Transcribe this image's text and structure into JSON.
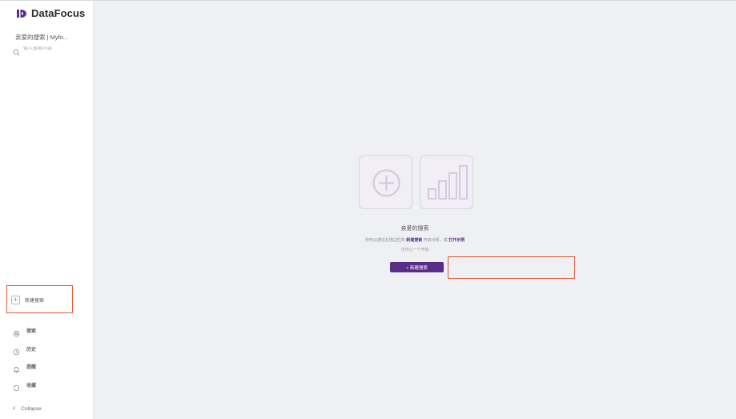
{
  "app": {
    "name": "DataFocus",
    "brand_color": "#5a2d88",
    "highlight_color": "#e05a3a"
  },
  "sidebar": {
    "workspace_label": "亲爱的搜索 | Myfo...",
    "search_placeholder": "输入搜索内容",
    "new_search_label": "新建搜索",
    "nav_items": [
      {
        "icon": "search-icon",
        "label": "搜索"
      },
      {
        "icon": "clock-icon",
        "label": "历史"
      },
      {
        "icon": "bell-icon",
        "label": "提醒"
      },
      {
        "icon": "history-icon",
        "label": "收藏"
      }
    ],
    "collapse_label": "Collapse"
  },
  "main": {
    "empty_state": {
      "title": "亲爱的搜索",
      "description_before": "你可以通过左侧边栏的",
      "description_link1": "新建搜索",
      "description_middle": "开启分析，或",
      "description_link2": "打开示例",
      "description_after": "",
      "subtext": "也可以一个开始",
      "create_button_label": "+ 新建搜索",
      "tiles": [
        {
          "icon": "add-circle-icon"
        },
        {
          "icon": "bar-chart-icon"
        }
      ]
    }
  }
}
